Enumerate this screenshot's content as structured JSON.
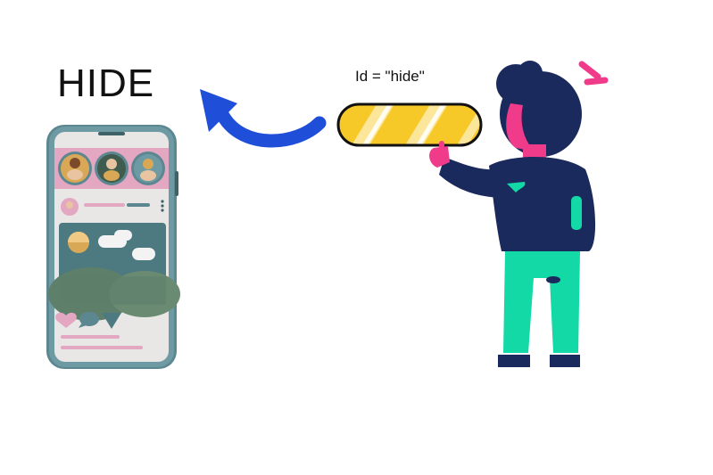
{
  "scene": {
    "title": "HIDE",
    "id_label": "Id = \"hide\""
  },
  "colors": {
    "arrow": "#1f4fd8",
    "pill_yellow": "#f7c928",
    "shirt_navy": "#1b2a5c",
    "pants_mint": "#12d9a6",
    "hair_pink": "#f03a8a",
    "phone_frame": "#5c8791",
    "phone_screen": "#e9e6e6",
    "card_teal": "#4d7a80",
    "accent_pink": "#e3a7c2"
  },
  "icons": [
    "phone-illustration",
    "curved-arrow-icon",
    "hide-button-pill",
    "person-illustration",
    "heart-icon",
    "chat-icon",
    "send-icon",
    "more-dots-icon"
  ]
}
